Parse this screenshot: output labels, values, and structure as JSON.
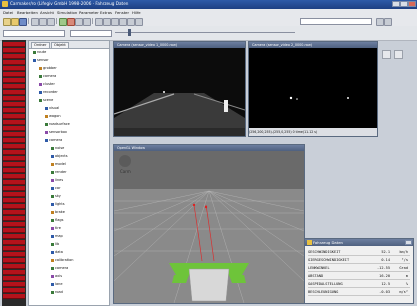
{
  "window": {
    "title": "Carmaker/ro (Lifegiv GmbH 1998-2006 · Fahrzeug Daten"
  },
  "menu": {
    "items": [
      "Datei",
      "Bearbeiten",
      "Ansicht",
      "Simulation",
      "Parameter",
      "Extras",
      "Fenster",
      "Hilfe"
    ]
  },
  "tree": {
    "tabs": [
      "Ordner",
      "Objekt"
    ],
    "items": [
      "route",
      "sensor",
      "grobber",
      "camera",
      "cluster",
      "recorder",
      "scene",
      "visual",
      "wagon",
      "roadsurface",
      "sensorbox",
      "camera",
      "noise",
      "objects",
      "model",
      "render",
      "lines",
      "car",
      "sky",
      "lights",
      "brake",
      "flags",
      "tire",
      "map",
      "lib",
      "data",
      "calibration",
      "camera",
      "axis",
      "lane",
      "road"
    ]
  },
  "video": {
    "left_title": "Camera (sensor_video 1_0000.raw)",
    "right_title": "Camera (sensor_video 2_0000.raw)",
    "status_text": "(256,200,255)-(255,0,255)  0  time(11.12 s)"
  },
  "view3d": {
    "title": "OpenGL Window",
    "logo": "Carm"
  },
  "dialog": {
    "title": "Fahrzeug Daten",
    "rows": [
      {
        "label": "GESCHWINDIGKEIT",
        "value": "52.1",
        "unit": "km/h"
      },
      {
        "label": "GIERGESCHWINDIGKEIT",
        "value": "0.14",
        "unit": "°/s"
      },
      {
        "label": "LENKWINKEL",
        "value": "-12.55",
        "unit": "Grad"
      },
      {
        "label": "ABSTAND",
        "value": "16.20",
        "unit": "m"
      },
      {
        "label": "GASPEDALSTELLUNG",
        "value": "12.5",
        "unit": "%"
      },
      {
        "label": "BESCHLEUNIGUNG",
        "value": "-0.03",
        "unit": "m/s²"
      }
    ]
  },
  "colors": {
    "red_column": "#b5121b",
    "title_bar": "#2e5aa8",
    "lane_green": "#6ec43a",
    "sky_gray": "#8a8a8a"
  }
}
